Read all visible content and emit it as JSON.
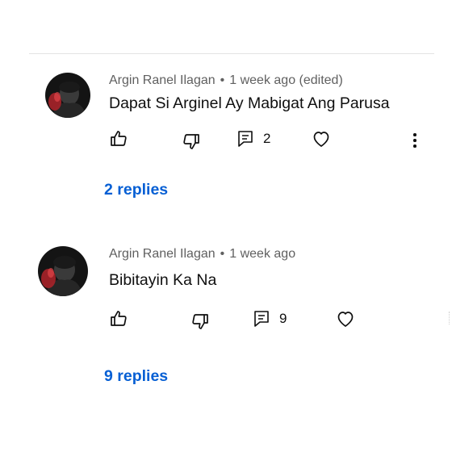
{
  "comments": [
    {
      "author": "Argin Ranel Ilagan",
      "separator": "•",
      "time": "1 week ago (edited)",
      "text": "Dapat Si Arginel Ay Mabigat Ang Parusa",
      "reply_count": "2",
      "replies_label": "2 replies"
    },
    {
      "author": "Argin Ranel Ilagan",
      "separator": "•",
      "time": "1 week ago",
      "text": "Bibitayin Ka Na",
      "reply_count": "9",
      "replies_label": "9 replies"
    }
  ],
  "icons": {
    "like": "thumbs-up-icon",
    "dislike": "thumbs-down-icon",
    "reply": "comment-icon",
    "heart": "heart-icon",
    "more": "more-vert-icon"
  },
  "colors": {
    "link": "#065fd4",
    "meta": "#606060",
    "text": "#0f0f0f",
    "divider": "#e3e3e3"
  }
}
